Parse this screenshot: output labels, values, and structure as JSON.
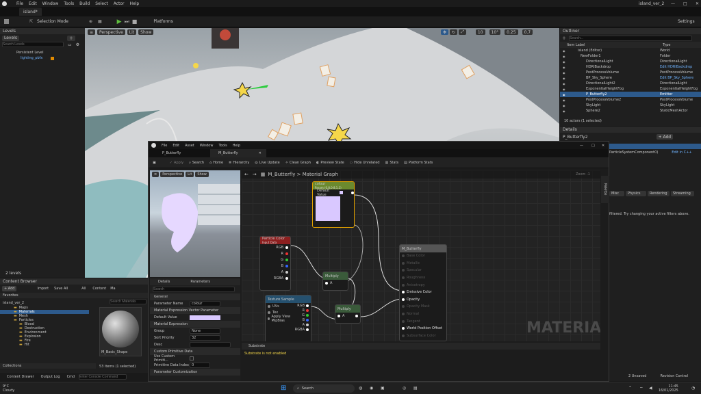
{
  "app": {
    "menu": [
      "File",
      "Edit",
      "Window",
      "Tools",
      "Build",
      "Select",
      "Actor",
      "Help"
    ],
    "project_name": "island_ver_2",
    "level_tab": "island*"
  },
  "main_toolbar": {
    "selection_mode": "Selection Mode",
    "platforms": "Platforms",
    "settings": "Settings"
  },
  "viewport": {
    "perspective": "Perspective",
    "lit": "Lit",
    "show": "Show",
    "grid_snap": "10",
    "rot_snap": "10°",
    "scale_snap": "0.25",
    "cam_speed": "0.7"
  },
  "levels": {
    "tab": "Levels",
    "levels_btn": "Levels",
    "search_placeholder": "Search Levels",
    "items": [
      "Persistent Level",
      "lighting_pbfx"
    ],
    "count": "2 levels"
  },
  "outliner": {
    "tab": "Outliner",
    "search_placeholder": "Search...",
    "col_label": "Item Label",
    "col_type": "Type",
    "rows": [
      {
        "label": "island (Editor)",
        "type": "World"
      },
      {
        "label": "NewFolder1",
        "type": "Folder"
      },
      {
        "label": "DirectionalLight",
        "type": "DirectionalLight"
      },
      {
        "label": "HDRIBackdrop",
        "type": "Edit HDRIBackdrop"
      },
      {
        "label": "PostProcessVolume",
        "type": "PostProcessVolume"
      },
      {
        "label": "BP_Sky_Sphere",
        "type": "Edit BP_Sky_Sphere"
      },
      {
        "label": "DirectionalLight2",
        "type": "DirectionalLight"
      },
      {
        "label": "ExponentialHeightFog",
        "type": "ExponentialHeightFog"
      },
      {
        "label": "P_Butterfly2",
        "type": "Emitter"
      },
      {
        "label": "PostProcessVolume2",
        "type": "PostProcessVolume"
      },
      {
        "label": "SkyLight",
        "type": "SkyLight"
      },
      {
        "label": "Sphere2",
        "type": "StaticMeshActor"
      }
    ],
    "status": "10 actors (1 selected)"
  },
  "details_right": {
    "tab": "Details",
    "object": "P_Butterfly2",
    "add": "+ Add",
    "component": "ParticleSystemComponent0)",
    "edit_cpp": "Edit in C++",
    "filters": [
      "Misc",
      "Physics",
      "Rendering",
      "Streaming"
    ],
    "message": "filtered. Try changing your active filters above.",
    "unsaved": "2 Unsaved",
    "revision": "Revision Control"
  },
  "content_browser": {
    "tab": "Content Browser",
    "add": "+ Add",
    "import": "Import",
    "save_all": "Save All",
    "path": [
      "All",
      "Content",
      "Ma"
    ],
    "favorites": "Favorites",
    "root": "island_ver_2",
    "folders": [
      "Maps",
      "Materials",
      "Mesh",
      "Particles",
      "Blood",
      "Destruction",
      "Environment",
      "Explosion",
      "Fire",
      "Hit"
    ],
    "search_placeholder": "Search Materials",
    "asset_name": "M_Basic_Shape",
    "status": "53 items (1 selected)",
    "collections": "Collections"
  },
  "bottom_bar": {
    "content_drawer": "Content Drawer",
    "output_log": "Output Log",
    "cmd": "Cmd",
    "console_placeholder": "Enter Console Command"
  },
  "mat_editor": {
    "menu": [
      "File",
      "Edit",
      "Asset",
      "Window",
      "Tools",
      "Help"
    ],
    "tabs": [
      "P_Butterfly",
      "M_Butterfly"
    ],
    "toolbar": [
      "Apply",
      "Search",
      "Home",
      "Hierarchy",
      "Live Update",
      "Clean Graph",
      "Preview State",
      "Hide Unrelated",
      "Stats",
      "Platform Stats"
    ],
    "preview_perspective": "Perspective",
    "preview_lit": "Lit",
    "preview_show": "Show",
    "breadcrumb": "M_Butterfly > Material Graph",
    "zoom": "Zoom -1",
    "watermark": "MATERIAL",
    "palette": "Palette",
    "details_tab": "Details",
    "parameters_tab": "Parameters",
    "details_search_placeholder": "Search",
    "sections": {
      "general": "General",
      "param_name_label": "Parameter Name",
      "param_name_value": "colour",
      "vector_param": "Material Expression Vector Parameter",
      "default_value": "Default Value",
      "mat_expr": "Material Expression",
      "group_label": "Group",
      "group_value": "None",
      "sort_label": "Sort Priority",
      "sort_value": "32",
      "desc_label": "Desc",
      "custom_prim": "Custom Primitive Data",
      "use_custom": "Use Custom Primiti...",
      "prim_index": "Primitive Data Index",
      "prim_index_value": "0",
      "param_custom": "Parameter Customization"
    },
    "substrate_tab": "Substrate",
    "substrate_msg": "Substrate is not enabled",
    "nodes": {
      "colour_title": "colour",
      "colour_sub": "Param (0.8,0.8,1,1)",
      "colour_default": "Default Value",
      "particle_title": "Particle Color",
      "particle_sub": "Input Data",
      "particle_pins": [
        "RGB",
        "R",
        "G",
        "B",
        "A",
        "RGBA"
      ],
      "mult1": "Multiply",
      "mult2": "Multiply",
      "tex_title": "Texture Sample",
      "tex_pins_left": [
        "UVs",
        "Tex",
        "Apply View MipBias"
      ],
      "tex_pins_right": [
        "RGB",
        "R",
        "G",
        "B",
        "A",
        "RGBA"
      ],
      "result_title": "M_Butterfly",
      "result_pins": [
        "Base Color",
        "Metallic",
        "Specular",
        "Roughness",
        "Anisotropy",
        "Emissive Color",
        "Opacity",
        "Opacity Mask",
        "Normal",
        "Tangent",
        "World Position Offset",
        "Subsurface Color"
      ]
    }
  },
  "taskbar": {
    "temp": "9°C",
    "weather": "Cloudy",
    "search": "Search",
    "time": "11:45",
    "date": "16/01/2025"
  },
  "colors": {
    "accent": "#2d5a8c",
    "param_green": "#6b8a2e",
    "node_red": "#8c1f1f",
    "tex_blue": "#25506e",
    "lavender": "#d9c8ff"
  }
}
